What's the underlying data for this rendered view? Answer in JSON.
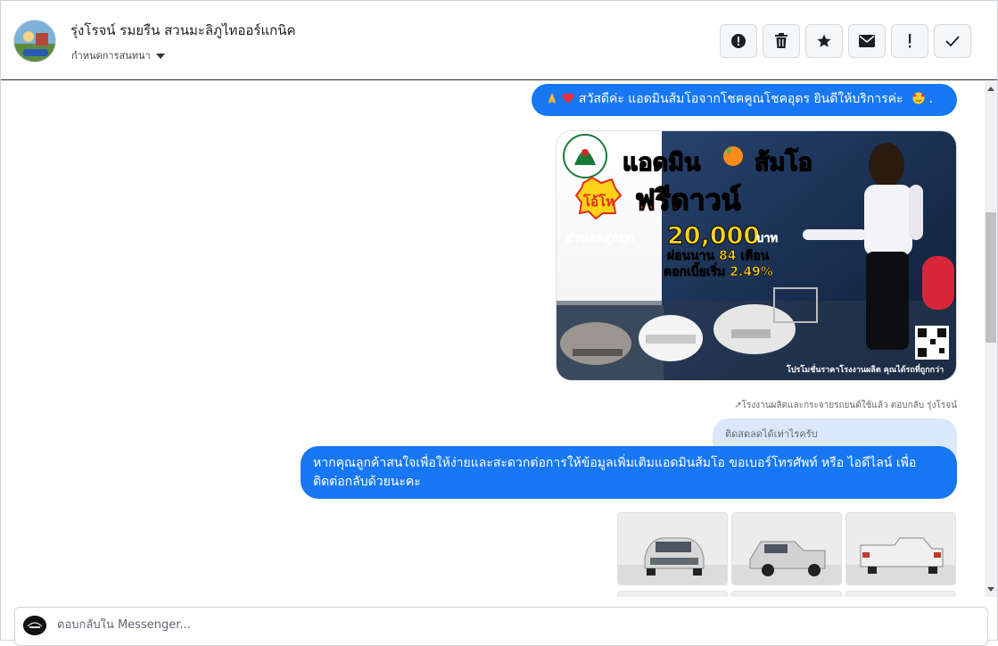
{
  "header": {
    "contact_name": "รุ่งโรจน์ รมยรืน สวนมะลิภูไทออร์แกนิค",
    "assign_label": "กำหนดการสนทนา",
    "actions": [
      {
        "icon": "exclamation-circle-icon"
      },
      {
        "icon": "trash-icon"
      },
      {
        "icon": "star-icon"
      },
      {
        "icon": "envelope-icon"
      },
      {
        "icon": "exclamation-icon"
      },
      {
        "icon": "check-icon"
      }
    ]
  },
  "messages": {
    "greeting": "สวัสดีค่ะ แอดมินส้มโอจากโชคคูณโชคอุดร ยินดีให้บริการค่ะ",
    "greeting_trailing": ".",
    "promo": {
      "brand": "แอดมิน",
      "brand2": "ส้มโอ",
      "badge": "โอ้โห",
      "headline": "ฟรีดาวน์",
      "discount_label": "ส่วนลดสูงสุด",
      "discount_amount": "20,000",
      "currency": "บาท",
      "installment": "ผ่อนนาน 84 เดือน",
      "interest": "ดอกเบี้ยเริ่ม 2.49%",
      "footer": "โปรโมชั่นราคาโรงงานผลิต คุณได้รถที่ถูกกว่า"
    },
    "reply_meta": "↗โรงงานผลิตและกระจายรถยนต์ใช้แล้ว ตอบกลับ รุ่งโรจน์",
    "quoted_text": "ติดสดลดได้เท่าไรครับ",
    "info_request": "หากคุณลูกค้าสนใจเพื่อให้ง่ายและสะดวกต่อการให้ข้อมูลเพิ่มเติมแอดมินส้มโอ ขอเบอร์โทรศัพท์ หรือ ไอดีไลน์ เพื่อติดต่อกลับด้วยนะคะ"
  },
  "composer": {
    "placeholder": "ตอบกลับใน Messenger..."
  },
  "colors": {
    "bubble": "#1877f2",
    "quote_bubble": "#dbe8fb",
    "promo_red": "#e52b1d",
    "promo_yellow": "#ffd21a"
  }
}
